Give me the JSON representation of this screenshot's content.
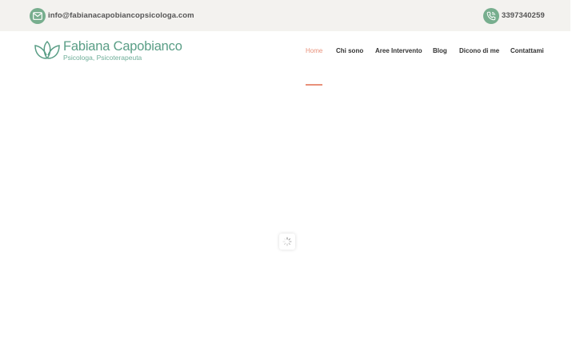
{
  "topbar": {
    "email": "info@fabianacapobiancopsicologa.com",
    "phone": "3397340259",
    "email_icon": "mail-icon",
    "phone_icon": "phone-icon",
    "icon_color": "#77ae8e"
  },
  "logo": {
    "title": "Fabiana Capobianco",
    "subtitle": "Psicologa, Psicoterapeuta",
    "icon": "lotus-logo-icon",
    "color": "#5a9e86"
  },
  "nav": {
    "items": [
      {
        "label": "Home",
        "active": true
      },
      {
        "label": "Chi sono",
        "active": false
      },
      {
        "label": "Aree Intervento",
        "active": false
      },
      {
        "label": "Blog",
        "active": false
      },
      {
        "label": "Dicono di me",
        "active": false
      },
      {
        "label": "Contattami",
        "active": false
      }
    ],
    "active_color": "#e8907a"
  },
  "loader": {
    "icon": "loading-spinner-icon"
  }
}
